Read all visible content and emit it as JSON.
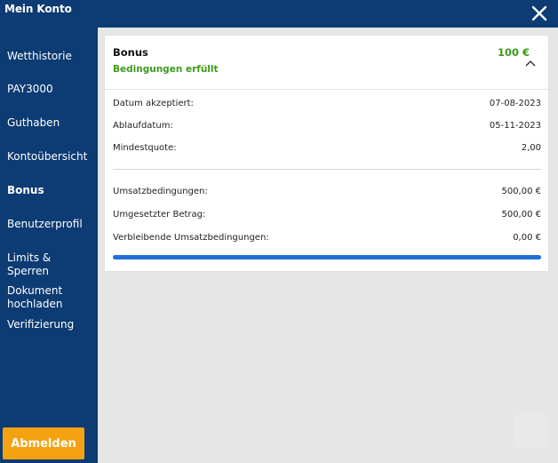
{
  "header": {
    "title": "Mein Konto",
    "close_icon": "close-icon"
  },
  "sidebar": {
    "items": [
      {
        "label": "Wetthistorie",
        "active": false
      },
      {
        "label": "PAY3000",
        "active": false
      },
      {
        "label": "Guthaben",
        "active": false
      },
      {
        "label": "Kontoübersicht",
        "active": false
      },
      {
        "label": "Bonus",
        "active": true
      },
      {
        "label": "Benutzerprofil",
        "active": false
      },
      {
        "label": "Limits & Sperren",
        "active": false
      },
      {
        "label": "Dokument hochladen",
        "active": false
      },
      {
        "label": "Verifizierung",
        "active": false
      }
    ],
    "logout_label": "Abmelden"
  },
  "bonus_card": {
    "title": "Bonus",
    "status": "Bedingungen erfüllt",
    "amount": "100 €",
    "expanded": true,
    "details": [
      {
        "label": "Datum akzeptiert:",
        "value": "07-08-2023"
      },
      {
        "label": "Ablaufdatum:",
        "value": "05-11-2023"
      },
      {
        "label": "Mindestquote:",
        "value": "2,00"
      }
    ],
    "wagering": [
      {
        "label": "Umsatzbedingungen:",
        "value": "500,00 €"
      },
      {
        "label": "Umgesetzter Betrag:",
        "value": "500,00 €"
      },
      {
        "label": "Verbleibende Umsatzbedingungen:",
        "value": "0,00 €"
      }
    ],
    "progress_percent": 100
  },
  "colors": {
    "navy": "#0d3b73",
    "accent_orange": "#f5a211",
    "success_green": "#3d9a1a",
    "progress_blue": "#1f6fd6",
    "background": "#e6e6e6"
  }
}
